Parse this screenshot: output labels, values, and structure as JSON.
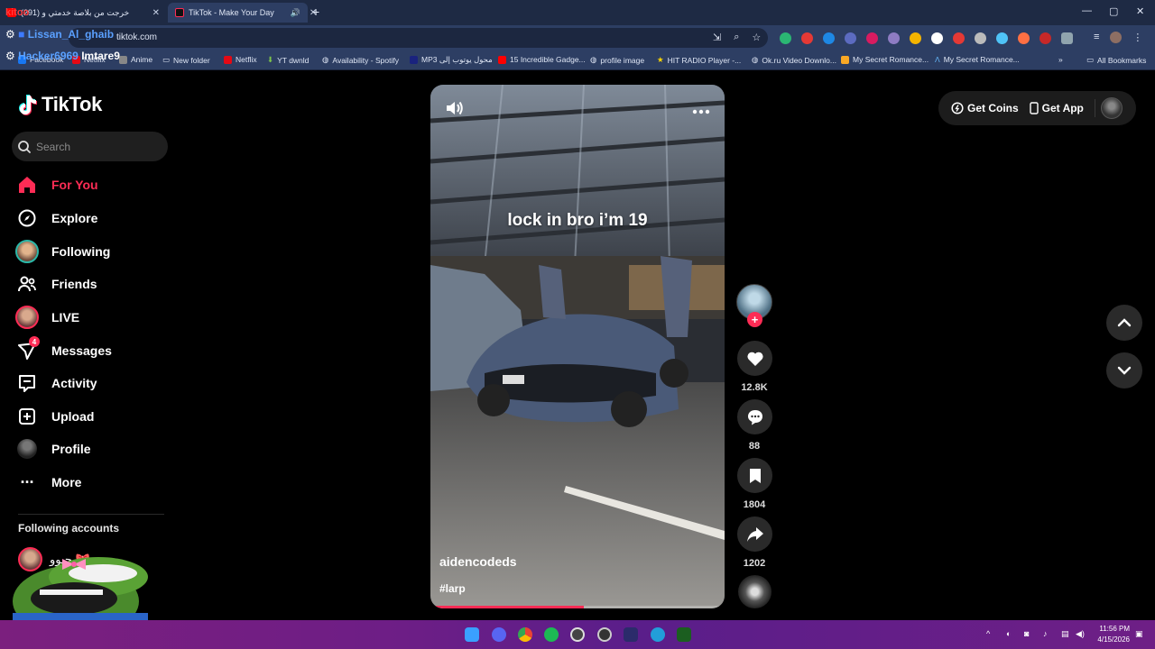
{
  "browser": {
    "tabs": [
      {
        "title": "(291) خرجت من بلاصة خدمتي و",
        "close": "✕"
      },
      {
        "title": "TikTok - Make Your Day",
        "close": "✕"
      }
    ],
    "new_tab": "+",
    "window_controls": [
      "—",
      "▢",
      "✕"
    ],
    "url": "tiktok.com",
    "overlay_names": [
      "Lissan_Al_ghaib",
      "Hacker6969",
      "Imtare9",
      "kitoo"
    ],
    "bookmarks": [
      "Facebook",
      "Netflix",
      "Anime",
      "New folder",
      "Netflix",
      "YT dwnld",
      "Availability - Spotify",
      "MP3 محول يوتوب إلى",
      "15 Incredible Gadge...",
      "profile image",
      "HIT RADIO Player -...",
      "Ok.ru Video Downlo...",
      "My Secret Romance...",
      "My Secret Romance...",
      "All Bookmarks"
    ]
  },
  "tiktok": {
    "logo": "TikTok",
    "search_placeholder": "Search",
    "nav": [
      {
        "label": "For You",
        "icon": "home-icon",
        "active": true
      },
      {
        "label": "Explore",
        "icon": "compass-icon"
      },
      {
        "label": "Following",
        "icon": "following-avatar"
      },
      {
        "label": "Friends",
        "icon": "friends-icon"
      },
      {
        "label": "LIVE",
        "icon": "live-avatar"
      },
      {
        "label": "Messages",
        "icon": "messages-icon",
        "badge": "4"
      },
      {
        "label": "Activity",
        "icon": "activity-icon"
      },
      {
        "label": "Upload",
        "icon": "upload-icon"
      },
      {
        "label": "Profile",
        "icon": "profile-avatar"
      },
      {
        "label": "More",
        "icon": "more-icon"
      }
    ],
    "following_title": "Following accounts",
    "following_accounts": [
      {
        "name": "جيوو 🎀"
      }
    ],
    "top_right": {
      "coins": "Get Coins",
      "app": "Get App"
    },
    "video": {
      "caption_overlay": "lock in bro i’m 19",
      "author": "aidencodeds",
      "hashtag": "#larp",
      "progress": 0.52
    },
    "actions": {
      "likes": "12.8K",
      "comments": "88",
      "saves": "1804",
      "shares": "1202"
    }
  },
  "taskbar": {
    "time": "11:56 PM",
    "date": "4/15/2026"
  },
  "colors": {
    "accent": "#fe2c55",
    "chrome": "#2d3e63",
    "sidebar_bg": "#000000"
  }
}
